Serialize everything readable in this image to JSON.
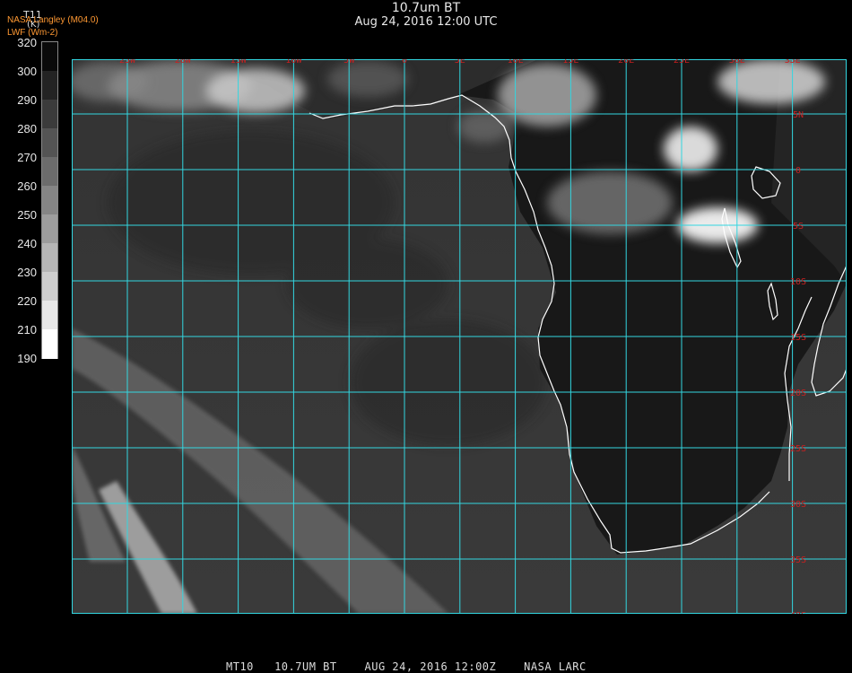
{
  "header": {
    "title": "10.7um BT",
    "datetime": "Aug 24, 2016 12:00 UTC"
  },
  "credit": {
    "line1": "NASA Langley (M04.0)",
    "line2": "LWF (Wm-2)"
  },
  "colorbar": {
    "title": "T11",
    "unit": "(K)",
    "ticks": [
      "320",
      "300",
      "290",
      "280",
      "270",
      "260",
      "250",
      "240",
      "230",
      "220",
      "210",
      "190"
    ]
  },
  "map": {
    "lon_labels": [
      "25W",
      "20W",
      "15W",
      "10W",
      "5W",
      "0",
      "5E",
      "10E",
      "15E",
      "20E",
      "25E",
      "30E",
      "35E"
    ],
    "lat_labels": [
      "5N",
      "0",
      "5S",
      "10S",
      "15S",
      "20S",
      "25S",
      "30S",
      "35S",
      "40S"
    ],
    "grid_color": "#33d6e0",
    "label_color": "#cc1f1f",
    "coast_color": "#ffffff"
  },
  "footer": "MT10   10.7UM BT    AUG 24, 2016 12:00Z    NASA LARC"
}
